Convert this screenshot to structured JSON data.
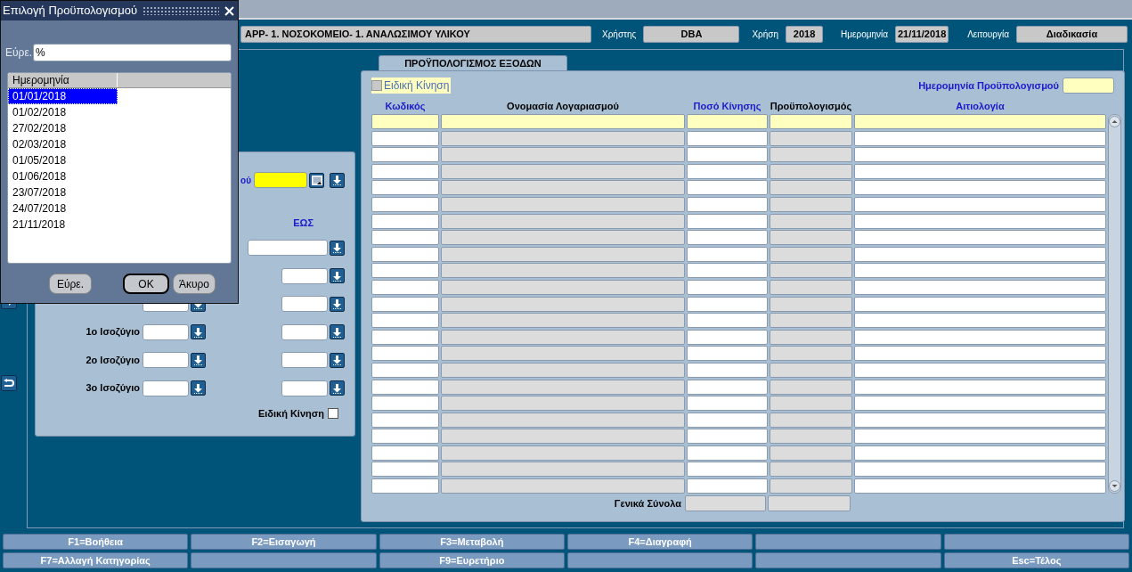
{
  "dialog": {
    "title": "Επιλογή Προϋπολογισμού",
    "find_label": "Εύρε.",
    "find_value": "%",
    "list": {
      "columns": [
        "Ημερομηνία"
      ],
      "rows": [
        {
          "value": "01/01/2018",
          "selected": true
        },
        {
          "value": "01/02/2018",
          "selected": false
        },
        {
          "value": "27/02/2018",
          "selected": false
        },
        {
          "value": "02/03/2018",
          "selected": false
        },
        {
          "value": "01/05/2018",
          "selected": false
        },
        {
          "value": "01/06/2018",
          "selected": false
        },
        {
          "value": "23/07/2018",
          "selected": false
        },
        {
          "value": "24/07/2018",
          "selected": false
        },
        {
          "value": "21/11/2018",
          "selected": false
        }
      ]
    },
    "buttons": [
      {
        "label": "Εύρε.",
        "default": false
      },
      {
        "label": "OK",
        "default": true
      },
      {
        "label": "Άκυρο",
        "default": false
      }
    ]
  },
  "header": {
    "title": "APP- 1. ΝΟΣΟΚΟΜΕΙΟ- 1. ΑΝΑΛΩΣΙΜΟΥ ΥΛΙΚΟΥ",
    "fields": [
      {
        "label": "Χρήστης",
        "value": "DBA"
      },
      {
        "label": "Χρήση",
        "value": "2018"
      },
      {
        "label": "Ημερομηνία",
        "value": "21/11/2018"
      },
      {
        "label": "Λειτουργία",
        "value": "Διαδικασία"
      }
    ]
  },
  "criteria": {
    "partial_label": "ού",
    "to_header": "ΕΩΣ",
    "rows": [
      {
        "kind": "wide"
      },
      {
        "kind": "to"
      },
      {
        "kind": "pair"
      },
      {
        "kind": "pair",
        "label": "1ο Ισοζύγιο"
      },
      {
        "kind": "pair",
        "label": "2ο Ισοζύγιο"
      },
      {
        "kind": "pair",
        "label": "3ο Ισοζύγιο"
      }
    ],
    "special": {
      "label": "Ειδική Κίνηση",
      "checked": false
    }
  },
  "budget": {
    "tab": "ΠΡΟΫΠΟΛΟΓΙΣΜΟΣ ΕΞΟΔΩΝ",
    "special": {
      "label": "Ειδική Κίνηση",
      "checked": false,
      "disabled": true
    },
    "date_label": "Ημερομηνία Προϋπολογισμού",
    "columns": [
      {
        "label": "Κωδικός",
        "color": "#1a1acc"
      },
      {
        "label": "Ονομασία Λογαριασμού",
        "color": "#000000"
      },
      {
        "label": "Ποσό Κίνησης",
        "color": "#1a1acc"
      },
      {
        "label": "Προϋπολογισμός",
        "color": "#000000"
      },
      {
        "label": "Αιτιολογία",
        "color": "#1a1acc"
      }
    ],
    "rows": [
      {
        "current": true
      },
      {
        "current": false
      },
      {
        "current": false
      },
      {
        "current": false
      },
      {
        "current": false
      },
      {
        "current": false
      },
      {
        "current": false
      },
      {
        "current": false
      },
      {
        "current": false
      },
      {
        "current": false
      },
      {
        "current": false
      },
      {
        "current": false
      },
      {
        "current": false
      },
      {
        "current": false
      },
      {
        "current": false
      },
      {
        "current": false
      },
      {
        "current": false
      },
      {
        "current": false
      },
      {
        "current": false
      },
      {
        "current": false
      },
      {
        "current": false
      },
      {
        "current": false
      },
      {
        "current": false
      }
    ],
    "totals_label": "Γενικά Σύνολα"
  },
  "function_keys": [
    [
      {
        "kind": "key",
        "label": "F1=Βοήθεια"
      },
      {
        "kind": "key",
        "label": "F2=Εισαγωγή"
      },
      {
        "kind": "key",
        "label": "F3=Μεταβολή"
      },
      {
        "kind": "key",
        "label": "F4=Διαγραφή"
      },
      {
        "kind": "blank"
      },
      {
        "kind": "blank"
      }
    ],
    [
      {
        "kind": "key",
        "label": "F7=Αλλαγή Κατηγορίας"
      },
      {
        "kind": "blank"
      },
      {
        "kind": "key",
        "label": "F9=Ευρετήριο"
      },
      {
        "kind": "blank"
      },
      {
        "kind": "blank"
      },
      {
        "kind": "key",
        "label": "Esc=Τέλος"
      }
    ]
  ]
}
